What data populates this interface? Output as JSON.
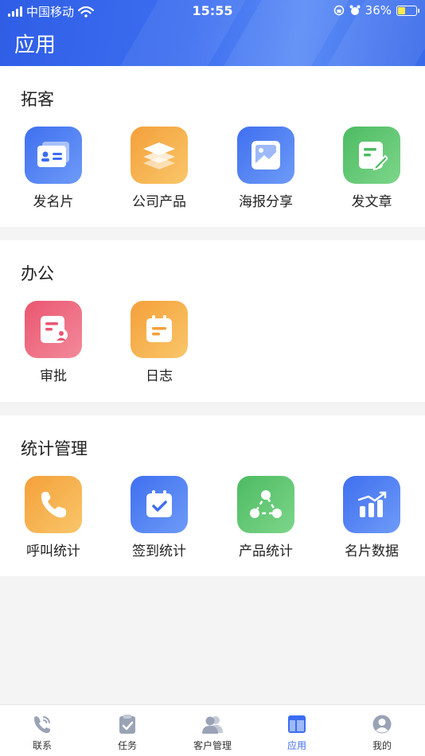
{
  "status_bar": {
    "carrier": "中国移动",
    "time": "15:55",
    "battery": "36%"
  },
  "header": {
    "title": "应用"
  },
  "sections": [
    {
      "title": "拓客",
      "items": [
        {
          "label": "发名片",
          "icon": "business-card-icon",
          "color": "blue"
        },
        {
          "label": "公司产品",
          "icon": "layers-icon",
          "color": "orange"
        },
        {
          "label": "海报分享",
          "icon": "image-icon",
          "color": "blue"
        },
        {
          "label": "发文章",
          "icon": "edit-document-icon",
          "color": "green"
        }
      ]
    },
    {
      "title": "办公",
      "items": [
        {
          "label": "审批",
          "icon": "approval-icon",
          "color": "red"
        },
        {
          "label": "日志",
          "icon": "log-icon",
          "color": "orange"
        }
      ]
    },
    {
      "title": "统计管理",
      "items": [
        {
          "label": "呼叫统计",
          "icon": "phone-icon",
          "color": "orange"
        },
        {
          "label": "签到统计",
          "icon": "calendar-check-icon",
          "color": "blue"
        },
        {
          "label": "产品统计",
          "icon": "share-nodes-icon",
          "color": "green"
        },
        {
          "label": "名片数据",
          "icon": "bar-chart-icon",
          "color": "blue"
        }
      ]
    }
  ],
  "tabbar": {
    "items": [
      {
        "label": "联系",
        "icon": "phone-call-icon"
      },
      {
        "label": "任务",
        "icon": "clipboard-icon"
      },
      {
        "label": "客户管理",
        "icon": "users-icon"
      },
      {
        "label": "应用",
        "icon": "apps-icon",
        "active": true
      },
      {
        "label": "我的",
        "icon": "profile-icon"
      }
    ]
  },
  "colors": {
    "accent": "#3b6cf0",
    "orange": "#f4a03a",
    "green": "#4dbb62",
    "red": "#ea5670"
  }
}
